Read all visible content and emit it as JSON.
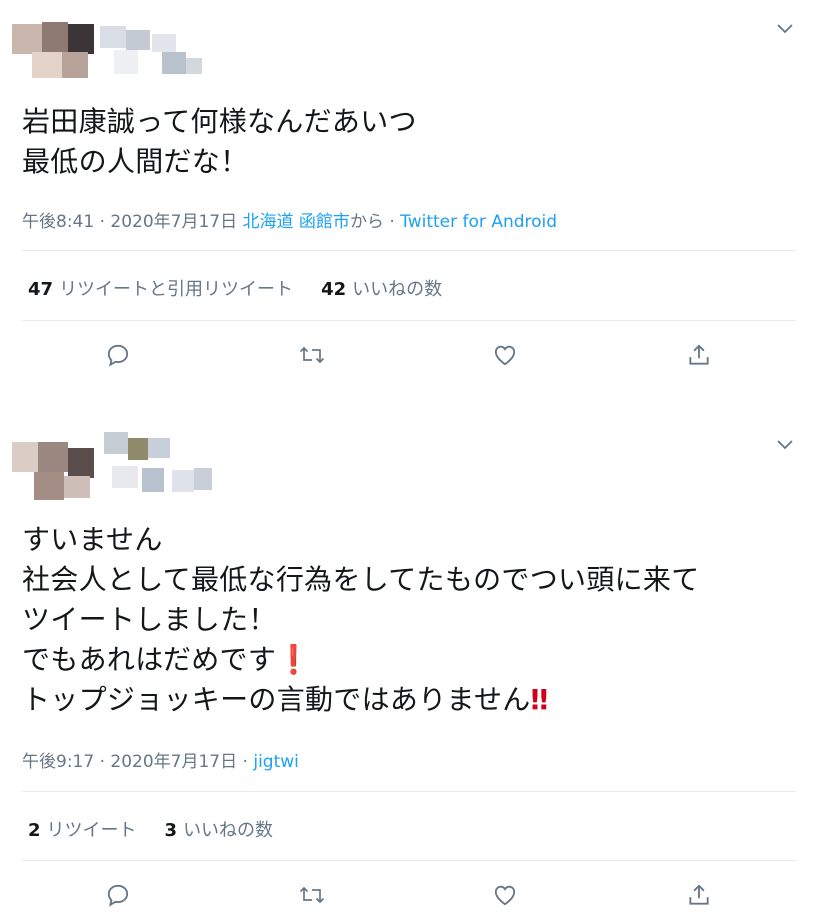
{
  "tweets": [
    {
      "text_lines": [
        "岩田康誠って何様なんだあいつ",
        "最低の人間だな！"
      ],
      "time": "午後8:41",
      "date": "2020年7月17日",
      "location": "北海道 函館市",
      "location_suffix": "から",
      "source": "Twitter for Android",
      "retweet_count": "47",
      "retweet_label": "リツイートと引用リツイート",
      "like_count": "42",
      "like_label": "いいねの数"
    },
    {
      "text_lines": [
        "すいません",
        "社会人として最低な行為をしてたものでつい頭に来て",
        "ツイートしました！",
        "でもあれはだめです",
        "トップジョッキーの言動ではありません"
      ],
      "emoji_1": "❗",
      "emoji_2": "‼",
      "time": "午後9:17",
      "date": "2020年7月17日",
      "source": "jigtwi",
      "retweet_count": "2",
      "retweet_label": "リツイート",
      "like_count": "3",
      "like_label": "いいねの数"
    }
  ],
  "separator": "·",
  "icons": [
    "chevron-down-icon",
    "reply-icon",
    "retweet-icon",
    "like-icon",
    "share-icon"
  ],
  "colors": {
    "link": "#1da1f2",
    "meta": "#657786",
    "text": "#14171a",
    "divider": "#e6ecf0",
    "emoji": "#d0021b"
  }
}
